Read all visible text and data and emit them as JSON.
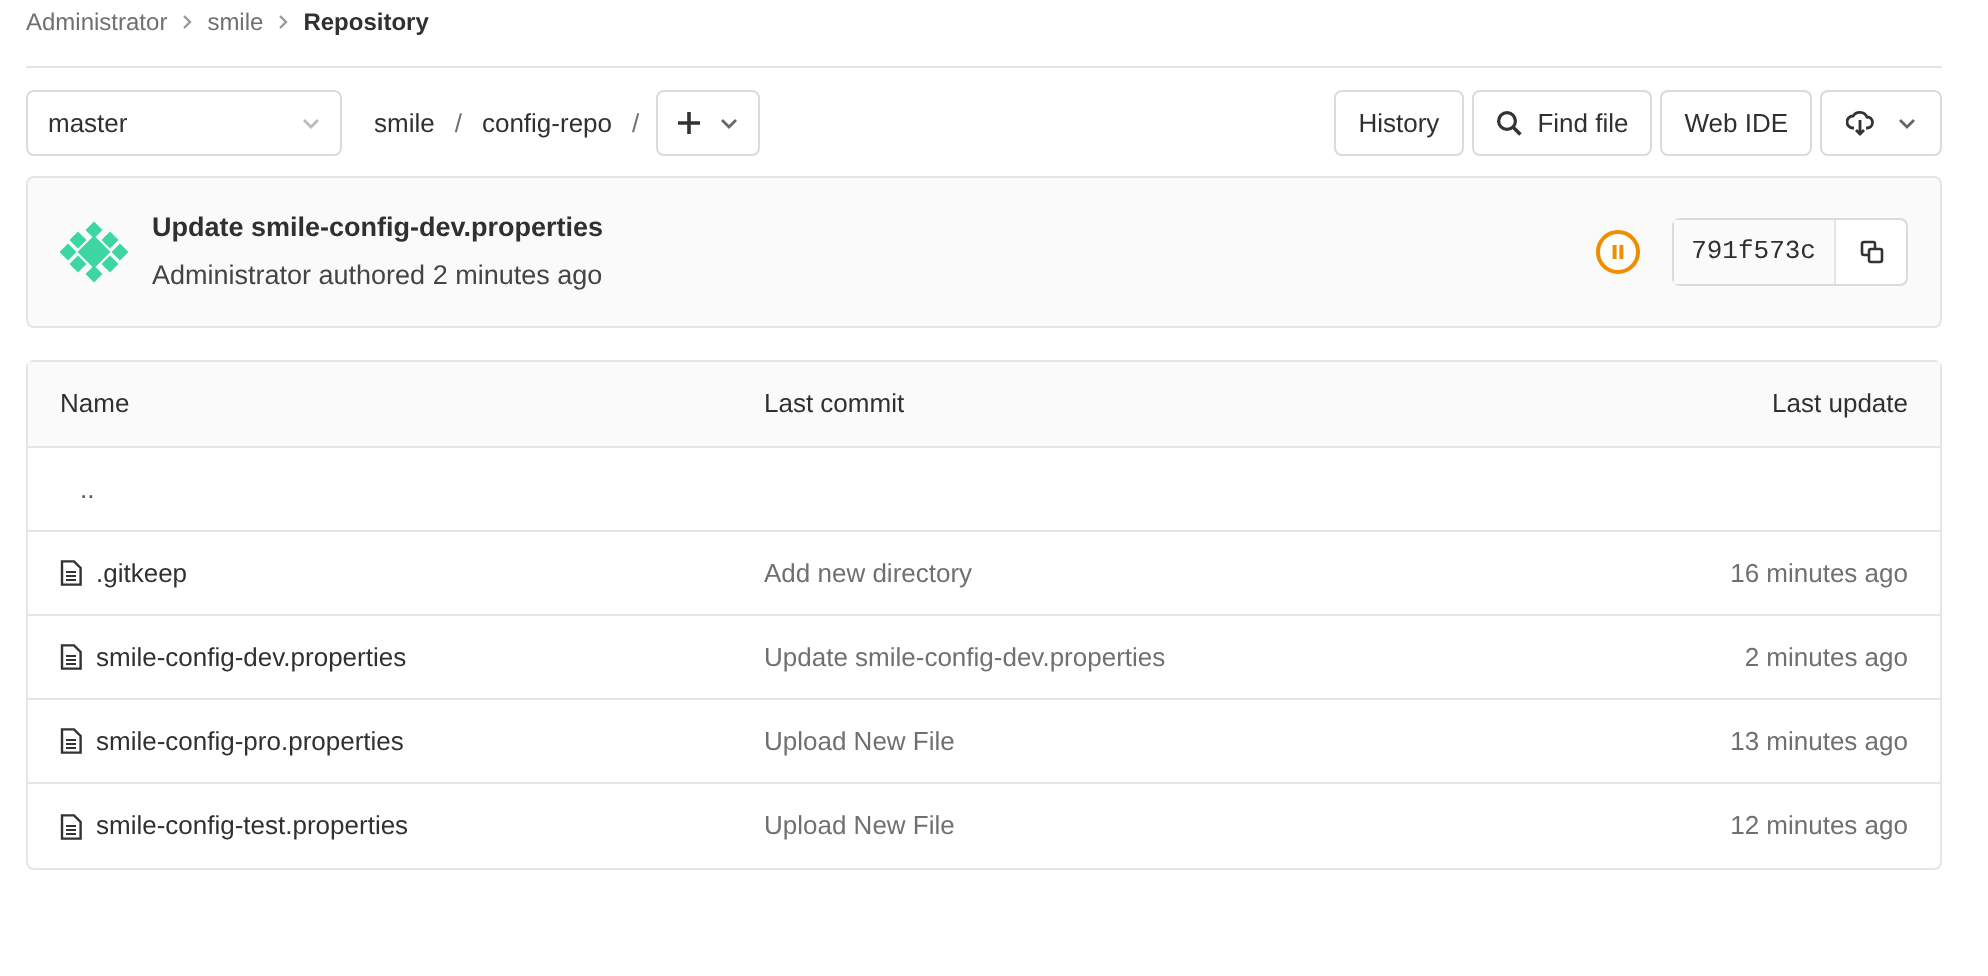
{
  "breadcrumbs": [
    {
      "label": "Administrator",
      "current": false
    },
    {
      "label": "smile",
      "current": false
    },
    {
      "label": "Repository",
      "current": true
    }
  ],
  "toolbar": {
    "branch": "master",
    "path": [
      "smile",
      "config-repo"
    ],
    "separator": "/",
    "buttons": [
      "History",
      "Find file",
      "Web IDE"
    ]
  },
  "commit": {
    "title": "Update smile-config-dev.properties",
    "author": "Administrator authored 2 minutes ago",
    "pipeline_paused": true,
    "sha": "791f573c"
  },
  "table": {
    "columns": [
      "Name",
      "Last commit",
      "Last update"
    ],
    "rows": [
      {
        "kind": "parent",
        "name": ".."
      },
      {
        "kind": "file",
        "name": ".gitkeep",
        "last_commit": "Add new directory",
        "last_update": "16 minutes ago"
      },
      {
        "kind": "file",
        "name": "smile-config-dev.properties",
        "last_commit": "Update smile-config-dev.properties",
        "last_update": "2 minutes ago"
      },
      {
        "kind": "file",
        "name": "smile-config-pro.properties",
        "last_commit": "Upload New File",
        "last_update": "13 minutes ago"
      },
      {
        "kind": "file",
        "name": "smile-config-test.properties",
        "last_commit": "Upload New File",
        "last_update": "12 minutes ago"
      }
    ]
  }
}
